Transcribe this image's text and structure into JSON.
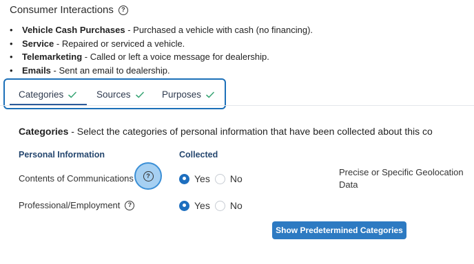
{
  "header": {
    "title": "Consumer Interactions",
    "help_icon": "?"
  },
  "bullets": [
    {
      "term": "Vehicle Cash Purchases",
      "desc": " - Purchased a vehicle with cash (no financing)."
    },
    {
      "term": "Service",
      "desc": " - Repaired or serviced a vehicle."
    },
    {
      "term": "Telemarketing",
      "desc": " - Called or left a voice message for dealership."
    },
    {
      "term": "Emails",
      "desc": " - Sent an email to dealership."
    }
  ],
  "tabs": [
    {
      "label": "Categories",
      "icon": "check-icon",
      "active": true
    },
    {
      "label": "Sources",
      "icon": "check-icon",
      "active": false
    },
    {
      "label": "Purposes",
      "icon": "check-icon",
      "active": false
    }
  ],
  "categories": {
    "heading_bold": "Categories",
    "heading_rest": " - Select the categories of personal information that have been collected about this co",
    "col_personal": "Personal Information",
    "col_collected": "Collected",
    "rows": [
      {
        "label": "Contents of Communications",
        "yes": "Yes",
        "no": "No",
        "selected": "Yes"
      },
      {
        "label": "Professional/Employment",
        "yes": "Yes",
        "no": "No",
        "selected": "Yes"
      }
    ],
    "side_item": "Precise or Specific Geolocation Data",
    "show_button": "Show Predetermined Categories"
  },
  "colors": {
    "accent": "#1e6fbf",
    "tab_check": "#3aa676",
    "highlight_border": "#1b6fb8",
    "header_text": "#24466e"
  }
}
